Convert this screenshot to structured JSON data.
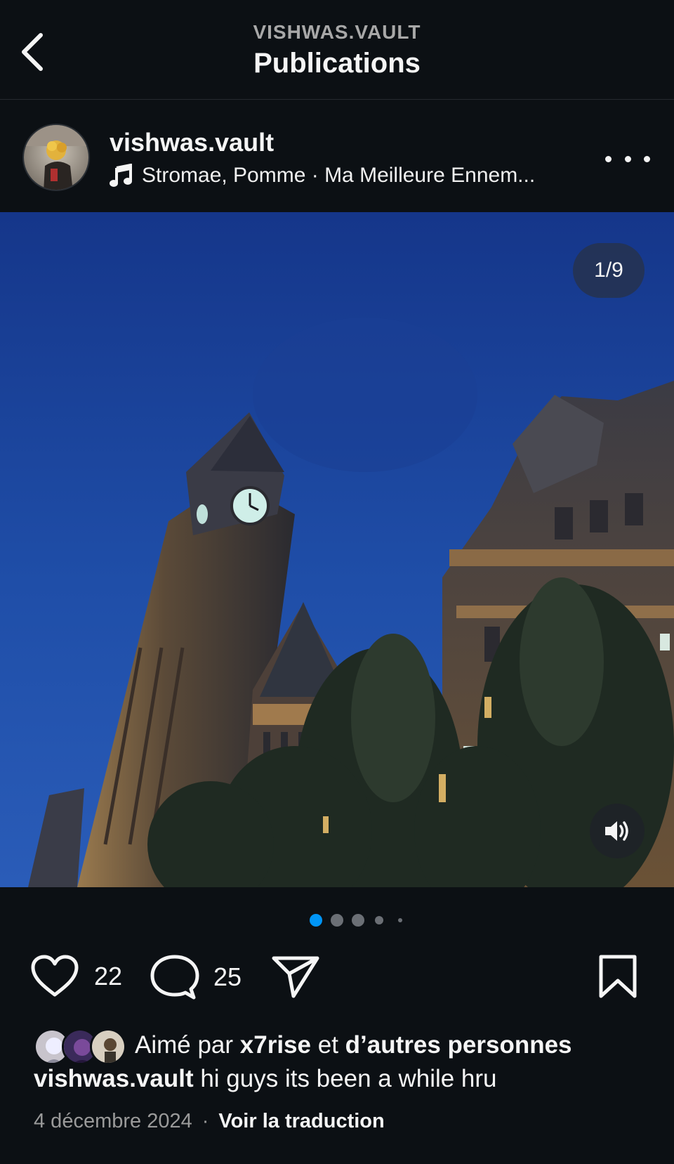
{
  "header": {
    "subtitle": "VISHWAS.VAULT",
    "title": "Publications"
  },
  "post": {
    "username": "vishwas.vault",
    "music": "Stromae, Pomme · Ma Meilleure Ennem...",
    "counter": "1/9",
    "carousel": {
      "dot_count": 5,
      "active_index": 0
    }
  },
  "actions": {
    "likes_count": "22",
    "comments_count": "25"
  },
  "likes": {
    "prefix": "Aimé par ",
    "user": "x7rise",
    "middle": " et ",
    "others": "d’autres personnes"
  },
  "caption": {
    "username": "vishwas.vault",
    "text": " hi guys its been a while hru"
  },
  "meta": {
    "date": "4 décembre 2024",
    "separator": "·",
    "translate": "Voir la traduction"
  },
  "colors": {
    "background": "#0c1014",
    "accent_dot": "#0095f6",
    "sky_blue": "#1f4ea8"
  },
  "icons": [
    "chevron-left-icon",
    "music-note-icon",
    "more-icon",
    "speaker-icon",
    "heart-icon",
    "comment-icon",
    "send-icon",
    "bookmark-icon"
  ]
}
